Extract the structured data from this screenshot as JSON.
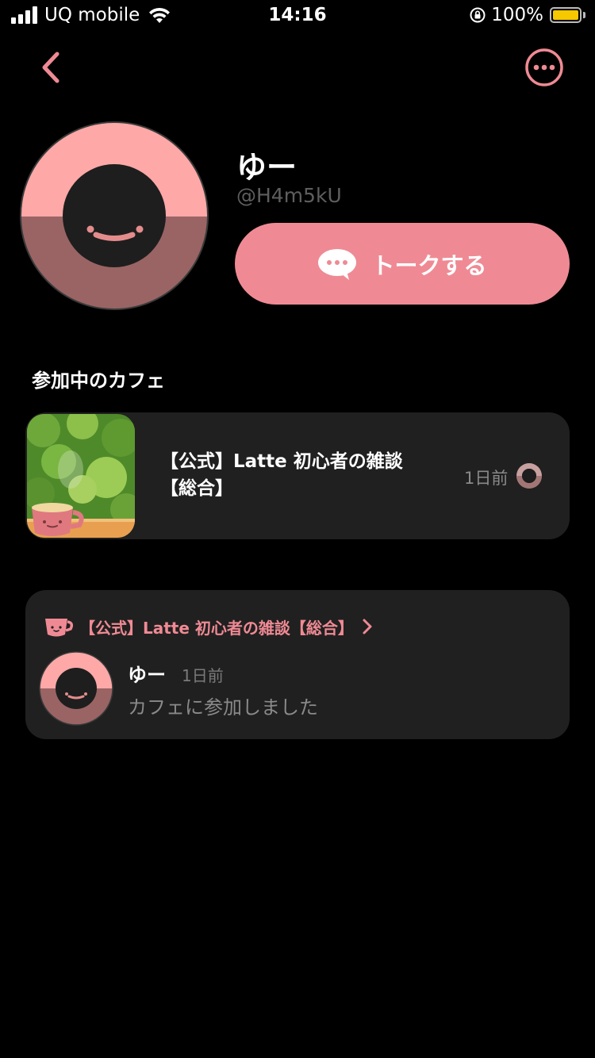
{
  "status_bar": {
    "carrier": "UQ mobile",
    "time": "14:16",
    "battery_percent": "100%"
  },
  "profile": {
    "name": "ゆー",
    "handle": "@H4m5kU",
    "talk_button_label": "トークする"
  },
  "cafes_section": {
    "title": "参加中のカフェ",
    "items": [
      {
        "name": "【公式】Latte 初心者の雑談【総合】",
        "time": "1日前"
      }
    ]
  },
  "activity": {
    "cafe_name": "【公式】Latte 初心者の雑談【総合】",
    "user_name": "ゆー",
    "time": "1日前",
    "message": "カフェに参加しました"
  },
  "colors": {
    "accent": "#ef8a94",
    "avatar_top": "#ffa8a8",
    "avatar_bottom": "#9a6464",
    "card_bg": "#202020",
    "battery": "#f5c800"
  },
  "icons": {
    "back": "chevron-left-icon",
    "more": "more-horizontal-icon",
    "talk": "chat-bubble-icon",
    "cup": "coffee-cup-icon"
  }
}
